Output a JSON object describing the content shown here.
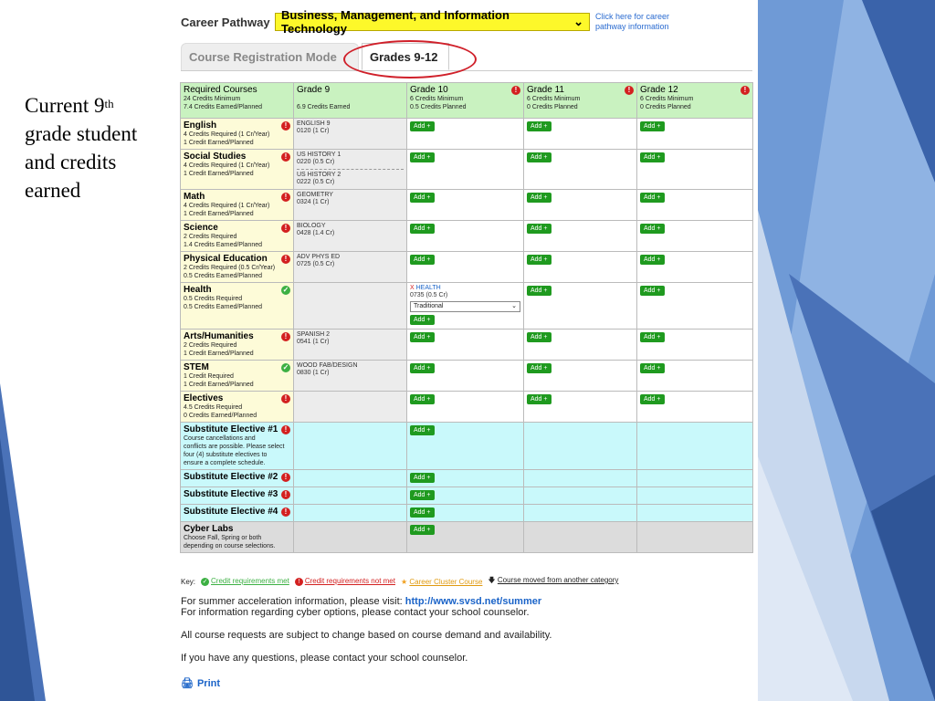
{
  "caption": {
    "line1a": "Current 9",
    "line1sup": "th",
    "line2": "grade student",
    "line3": "and credits",
    "line4": "earned"
  },
  "pathway": {
    "label": "Career Pathway",
    "value": "Business, Management, and Information Technology",
    "link_line1": "Click here for career",
    "link_line2": "pathway information"
  },
  "tabs": {
    "mode": "Course Registration Mode",
    "grades": "Grades 9-12"
  },
  "header": {
    "req": {
      "title": "Required Courses",
      "l1": "24 Credits Minimum",
      "l2": "7.4 Credits Earned/Planned"
    },
    "g9": {
      "title": "Grade 9",
      "l1": "6.9 Credits Earned"
    },
    "g10": {
      "title": "Grade 10",
      "l1": "6 Credits Minimum",
      "l2": "0.5 Credits Planned"
    },
    "g11": {
      "title": "Grade 11",
      "l1": "6 Credits Minimum",
      "l2": "0 Credits Planned"
    },
    "g12": {
      "title": "Grade 12",
      "l1": "6 Credits Minimum",
      "l2": "0 Credits Planned"
    }
  },
  "add_label": "Add +",
  "rows": {
    "english": {
      "name": "English",
      "l1": "4 Credits Required (1 Cr/Year)",
      "l2": "1 Credit Earned/Planned",
      "c1": "ENGLISH 9",
      "c1b": "0120 (1 Cr)"
    },
    "social": {
      "name": "Social Studies",
      "l1": "4 Credits Required (1 Cr/Year)",
      "l2": "1 Credit Earned/Planned",
      "c1": "US HISTORY 1",
      "c1b": "0220 (0.5 Cr)",
      "c2": "US HISTORY 2",
      "c2b": "0222 (0.5 Cr)"
    },
    "math": {
      "name": "Math",
      "l1": "4 Credits Required (1 Cr/Year)",
      "l2": "1 Credit Earned/Planned",
      "c1": "GEOMETRY",
      "c1b": "0324 (1 Cr)"
    },
    "science": {
      "name": "Science",
      "l1": "2 Credits Required",
      "l2": "1.4 Credits Earned/Planned",
      "c1": "BIOLOGY",
      "c1b": "0428 (1.4 Cr)"
    },
    "pe": {
      "name": "Physical Education",
      "l1": "2 Credits Required (0.5 Cr/Year)",
      "l2": "0.5 Credits Earned/Planned",
      "c1": "ADV PHYS ED",
      "c1b": "0725 (0.5 Cr)"
    },
    "health": {
      "name": "Health",
      "l1": "0.5 Credits Required",
      "l2": "0.5 Credits Earned/Planned",
      "g10x": "X",
      "g10c": "HEALTH",
      "g10b": "0735 (0.5 Cr)",
      "g10sel": "Traditional"
    },
    "arts": {
      "name": "Arts/Humanities",
      "l1": "2 Credits Required",
      "l2": "1 Credit Earned/Planned",
      "c1": "SPANISH 2",
      "c1b": "0541 (1 Cr)"
    },
    "stem": {
      "name": "STEM",
      "l1": "1 Credit Required",
      "l2": "1 Credit Earned/Planned",
      "c1": "WOOD FAB/DESIGN",
      "c1b": "0830 (1 Cr)"
    },
    "electives": {
      "name": "Electives",
      "l1": "4.5 Credits Required",
      "l2": "0 Credits Earned/Planned"
    },
    "sub1": {
      "name": "Substitute Elective #1",
      "l1": "Course cancellations and",
      "l2": "conflicts are possible. Please select",
      "l3": "four (4) substitute electives to",
      "l4": "ensure a complete schedule."
    },
    "sub2": {
      "name": "Substitute Elective #2"
    },
    "sub3": {
      "name": "Substitute Elective #3"
    },
    "sub4": {
      "name": "Substitute Elective #4"
    },
    "cyber": {
      "name": "Cyber Labs",
      "l1": "Choose Fall, Spring or both",
      "l2": "depending on course selections."
    }
  },
  "key": {
    "label": "Key:",
    "met": "Credit requirements met",
    "notmet": "Credit requirements not met",
    "cluster": "Career Cluster Course",
    "moved": "Course moved from another category"
  },
  "notes": {
    "summer": "For summer acceleration information, please visit:",
    "summer_url": "http://www.svsd.net/summer",
    "cyber": "For information regarding cyber options, please contact your school counselor.",
    "change": "All course requests are subject to change based on course demand and availability.",
    "questions": "If you have any questions, please contact your school counselor."
  },
  "print": "Print",
  "colors": {
    "pathway_bg": "#fdf82a",
    "header_green": "#c9f2c0",
    "req_yellow": "#fdfbd8",
    "sub_cyan": "#c9f9fb",
    "add_green": "#1f9a1f",
    "alert_red": "#d32020",
    "ok_green": "#3cb043"
  }
}
